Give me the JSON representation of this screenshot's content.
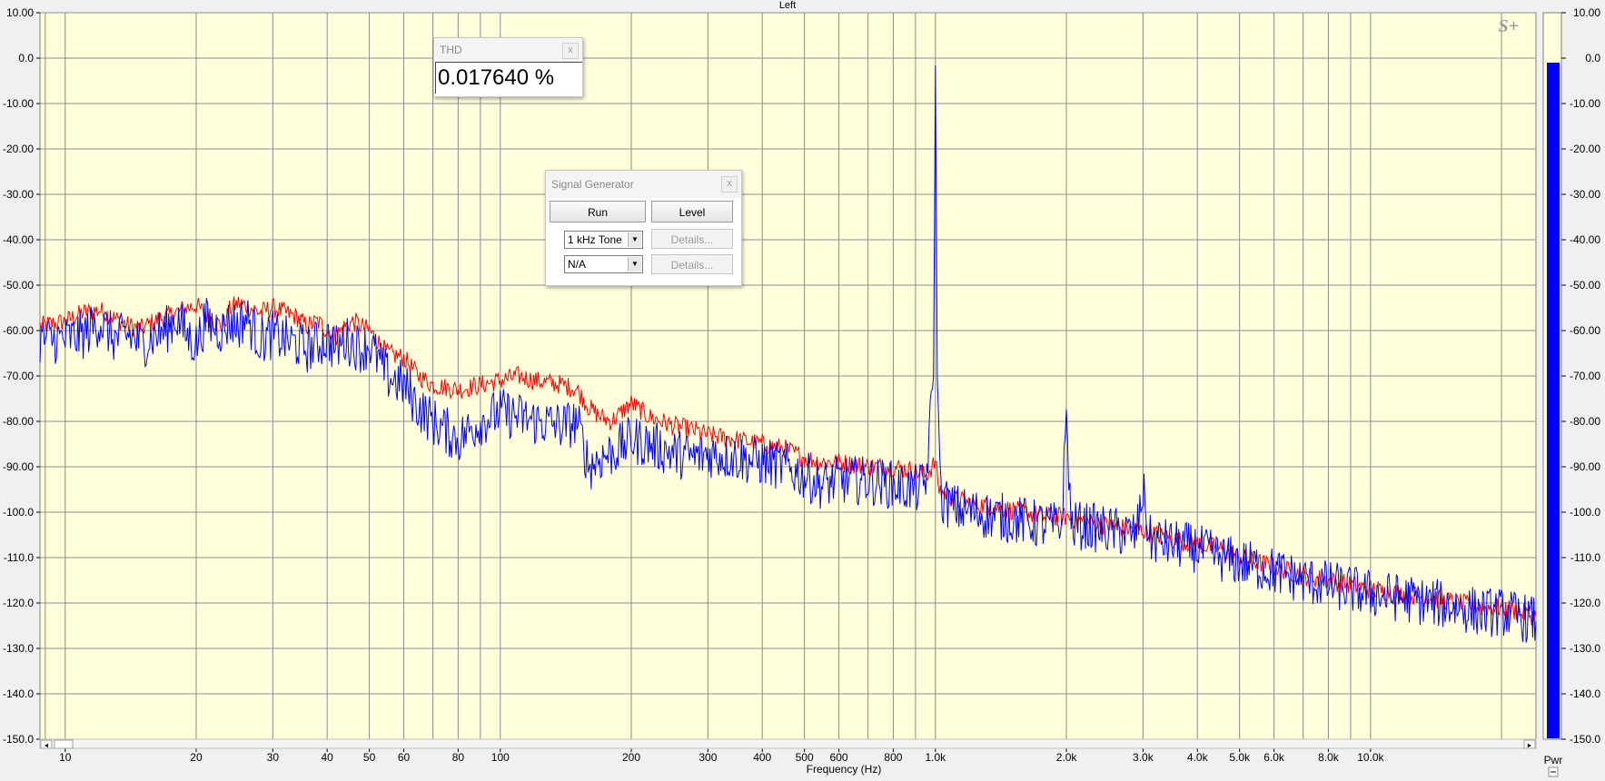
{
  "chart_data": {
    "type": "line",
    "title": "Left",
    "xlabel": "Frequency (Hz)",
    "ylabel": "",
    "x_scale": "log",
    "xlim": [
      8.75,
      24000
    ],
    "ylim": [
      -150,
      10
    ],
    "grid": true,
    "y_ticks": [
      "10.00",
      "0.0",
      "-10.00",
      "-20.00",
      "-30.00",
      "-40.00",
      "-50.00",
      "-60.00",
      "-70.00",
      "-80.00",
      "-90.00",
      "-100.0",
      "-110.0",
      "-120.0",
      "-130.0",
      "-140.0",
      "-150.0"
    ],
    "x_tick_labels": [
      {
        "f": 10,
        "label": "10"
      },
      {
        "f": 20,
        "label": "20"
      },
      {
        "f": 30,
        "label": "30"
      },
      {
        "f": 40,
        "label": "40"
      },
      {
        "f": 50,
        "label": "50"
      },
      {
        "f": 60,
        "label": "60"
      },
      {
        "f": 80,
        "label": "80"
      },
      {
        "f": 100,
        "label": "100"
      },
      {
        "f": 200,
        "label": "200"
      },
      {
        "f": 300,
        "label": "300"
      },
      {
        "f": 400,
        "label": "400"
      },
      {
        "f": 500,
        "label": "500"
      },
      {
        "f": 600,
        "label": "600"
      },
      {
        "f": 800,
        "label": "800"
      },
      {
        "f": 1000,
        "label": "1.0k"
      },
      {
        "f": 2000,
        "label": "2.0k"
      },
      {
        "f": 3000,
        "label": "3.0k"
      },
      {
        "f": 4000,
        "label": "4.0k"
      },
      {
        "f": 5000,
        "label": "5.0k"
      },
      {
        "f": 6000,
        "label": "6.0k"
      },
      {
        "f": 8000,
        "label": "8.0k"
      },
      {
        "f": 10000,
        "label": "10.0k"
      }
    ],
    "series": [
      {
        "color": "#ff0000",
        "points": [
          [
            8.75,
            -59
          ],
          [
            10,
            -58
          ],
          [
            11,
            -56
          ],
          [
            12,
            -55.5
          ],
          [
            14,
            -59
          ],
          [
            15,
            -59.5
          ],
          [
            16,
            -58
          ],
          [
            17,
            -57
          ],
          [
            18,
            -56
          ],
          [
            19,
            -55
          ],
          [
            20,
            -54.5
          ],
          [
            22,
            -58
          ],
          [
            23,
            -59
          ],
          [
            24,
            -55
          ],
          [
            25,
            -54
          ],
          [
            26,
            -54.5
          ],
          [
            28,
            -56
          ],
          [
            30,
            -55
          ],
          [
            32,
            -56
          ],
          [
            34,
            -57
          ],
          [
            36,
            -59
          ],
          [
            38,
            -58
          ],
          [
            40,
            -60
          ],
          [
            42,
            -61
          ],
          [
            44,
            -59
          ],
          [
            46,
            -58
          ],
          [
            48,
            -59
          ],
          [
            50,
            -60
          ],
          [
            55,
            -65
          ],
          [
            60,
            -66
          ],
          [
            65,
            -70
          ],
          [
            70,
            -72
          ],
          [
            80,
            -73
          ],
          [
            90,
            -72
          ],
          [
            100,
            -71
          ],
          [
            110,
            -70
          ],
          [
            120,
            -71
          ],
          [
            140,
            -72
          ],
          [
            150,
            -73
          ],
          [
            160,
            -77
          ],
          [
            170,
            -79
          ],
          [
            180,
            -80
          ],
          [
            200,
            -76
          ],
          [
            220,
            -79
          ],
          [
            250,
            -81
          ],
          [
            280,
            -82
          ],
          [
            300,
            -83
          ],
          [
            350,
            -84
          ],
          [
            400,
            -85
          ],
          [
            450,
            -86
          ],
          [
            500,
            -88
          ],
          [
            550,
            -89
          ],
          [
            600,
            -89
          ],
          [
            700,
            -90
          ],
          [
            800,
            -90
          ],
          [
            900,
            -91
          ],
          [
            950,
            -92
          ],
          [
            1000,
            -89
          ],
          [
            1020,
            -95
          ],
          [
            1100,
            -97
          ],
          [
            1200,
            -98
          ],
          [
            1400,
            -99
          ],
          [
            1600,
            -100
          ],
          [
            1800,
            -101
          ],
          [
            2000,
            -101
          ],
          [
            2200,
            -102
          ],
          [
            2500,
            -103
          ],
          [
            3000,
            -104
          ],
          [
            3500,
            -106
          ],
          [
            4000,
            -107
          ],
          [
            4500,
            -108
          ],
          [
            5000,
            -110
          ],
          [
            6000,
            -112
          ],
          [
            7000,
            -114
          ],
          [
            8000,
            -115
          ],
          [
            9000,
            -116
          ],
          [
            10000,
            -117
          ],
          [
            12000,
            -118
          ],
          [
            14000,
            -119
          ],
          [
            16000,
            -120
          ],
          [
            18000,
            -121
          ],
          [
            20000,
            -121
          ],
          [
            22000,
            -122
          ],
          [
            24000,
            -123
          ]
        ]
      },
      {
        "color": "#0000ff",
        "points": [
          [
            8.75,
            -62
          ],
          [
            10,
            -62
          ],
          [
            11,
            -61
          ],
          [
            12,
            -58
          ],
          [
            13,
            -62
          ],
          [
            14,
            -61
          ],
          [
            15,
            -63
          ],
          [
            16,
            -61
          ],
          [
            17,
            -60
          ],
          [
            18,
            -57
          ],
          [
            19,
            -61
          ],
          [
            20,
            -63
          ],
          [
            21,
            -58
          ],
          [
            22,
            -59
          ],
          [
            23,
            -60
          ],
          [
            24,
            -58
          ],
          [
            25,
            -59
          ],
          [
            26,
            -57
          ],
          [
            28,
            -62
          ],
          [
            30,
            -61
          ],
          [
            32,
            -62
          ],
          [
            34,
            -63
          ],
          [
            36,
            -64
          ],
          [
            38,
            -63
          ],
          [
            40,
            -62
          ],
          [
            42,
            -64
          ],
          [
            44,
            -62
          ],
          [
            46,
            -63
          ],
          [
            48,
            -64
          ],
          [
            50,
            -63
          ],
          [
            55,
            -70
          ],
          [
            60,
            -72
          ],
          [
            65,
            -77
          ],
          [
            70,
            -80
          ],
          [
            80,
            -84
          ],
          [
            90,
            -80
          ],
          [
            100,
            -78
          ],
          [
            110,
            -79
          ],
          [
            120,
            -80
          ],
          [
            140,
            -81
          ],
          [
            150,
            -80
          ],
          [
            160,
            -90
          ],
          [
            170,
            -88
          ],
          [
            180,
            -87
          ],
          [
            200,
            -84
          ],
          [
            220,
            -85
          ],
          [
            250,
            -87
          ],
          [
            280,
            -88
          ],
          [
            300,
            -87
          ],
          [
            350,
            -88
          ],
          [
            400,
            -89
          ],
          [
            450,
            -90
          ],
          [
            500,
            -92
          ],
          [
            550,
            -94
          ],
          [
            600,
            -93
          ],
          [
            700,
            -93
          ],
          [
            800,
            -94
          ],
          [
            900,
            -95
          ],
          [
            950,
            -94
          ],
          [
            990,
            -70
          ],
          [
            1000,
            -2
          ],
          [
            1010,
            -70
          ],
          [
            1030,
            -97
          ],
          [
            1100,
            -99
          ],
          [
            1200,
            -100
          ],
          [
            1400,
            -101
          ],
          [
            1600,
            -102
          ],
          [
            1800,
            -103
          ],
          [
            1950,
            -103
          ],
          [
            2000,
            -78
          ],
          [
            2050,
            -103
          ],
          [
            2200,
            -103
          ],
          [
            2500,
            -104
          ],
          [
            2900,
            -105
          ],
          [
            3000,
            -95
          ],
          [
            3100,
            -106
          ],
          [
            3500,
            -107
          ],
          [
            4000,
            -108
          ],
          [
            4500,
            -110
          ],
          [
            5000,
            -111
          ],
          [
            6000,
            -113
          ],
          [
            7000,
            -115
          ],
          [
            8000,
            -116
          ],
          [
            9000,
            -117
          ],
          [
            10000,
            -118
          ],
          [
            12000,
            -119
          ],
          [
            14000,
            -120
          ],
          [
            16000,
            -121
          ],
          [
            18000,
            -122
          ],
          [
            20000,
            -122
          ],
          [
            22000,
            -123
          ],
          [
            24000,
            -124
          ]
        ]
      }
    ],
    "level_meter": {
      "level_db": -1,
      "y_ticks": [
        "10.00",
        "0.0",
        "-10.00",
        "-20.00",
        "-30.00",
        "-40.00",
        "-50.00",
        "-60.00",
        "-70.00",
        "-80.00",
        "-90.00",
        "-100.0",
        "-110.0",
        "-120.0",
        "-130.0",
        "-140.0",
        "-150.0"
      ],
      "label": "Pwr"
    },
    "watermark": "S+"
  },
  "thd": {
    "title": "THD",
    "value": "0.017640 %"
  },
  "siggen": {
    "title": "Signal Generator",
    "run": "Run",
    "level": "Level",
    "tone_select": "1 kHz Tone",
    "second_select": "N/A",
    "details1": "Details...",
    "details2": "Details..."
  },
  "close_glyph": "x",
  "scroll": {
    "left": "◄",
    "right": "►"
  }
}
